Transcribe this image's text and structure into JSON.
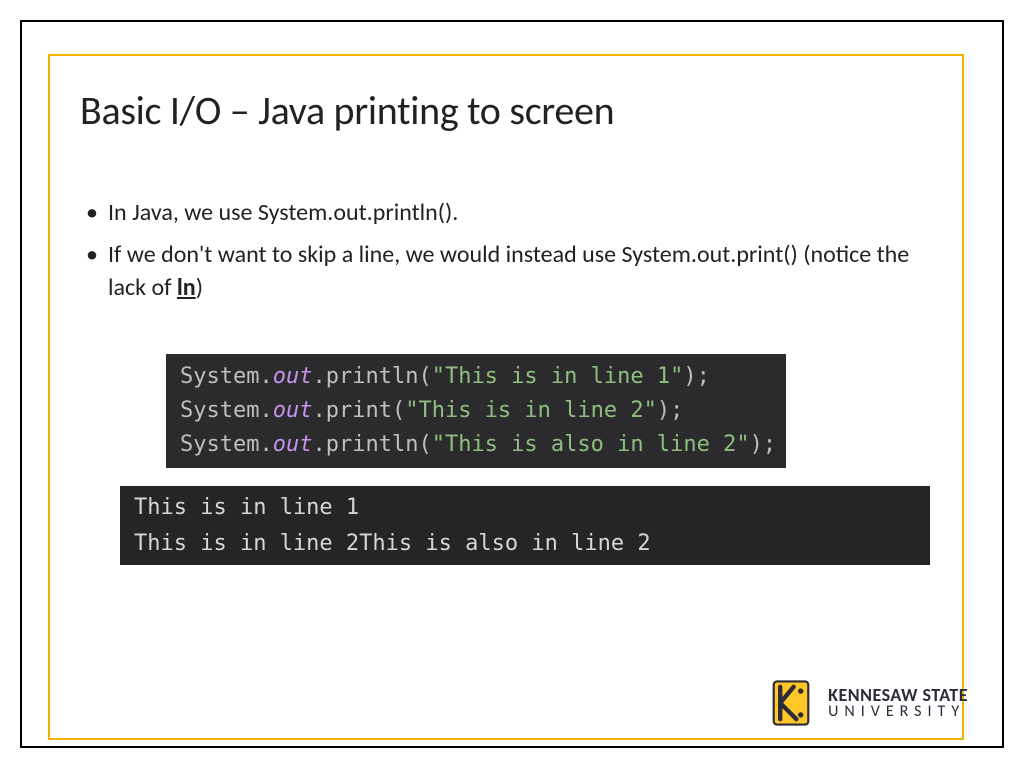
{
  "slide": {
    "title": "Basic I/O – Java printing to screen",
    "bullets": [
      {
        "text": "In Java, we use System.out.println()."
      },
      {
        "prefix": "If we don't want to skip a line, we would instead use System.out.print() (notice the lack of ",
        "emph": "ln",
        "suffix": ")"
      }
    ],
    "code": {
      "lines": [
        {
          "cls": "System",
          "field": "out",
          "method": "println",
          "str": "\"This is in line 1\""
        },
        {
          "cls": "System",
          "field": "out",
          "method": "print",
          "str": "\"This is in line 2\""
        },
        {
          "cls": "System",
          "field": "out",
          "method": "println",
          "str": "\"This is also in line 2\""
        }
      ]
    },
    "output": "This is in line 1\nThis is in line 2This is also in line 2",
    "logo": {
      "line1": "KENNESAW STATE",
      "line2": "UNIVERSITY"
    },
    "colors": {
      "accent": "#f0b400"
    }
  }
}
